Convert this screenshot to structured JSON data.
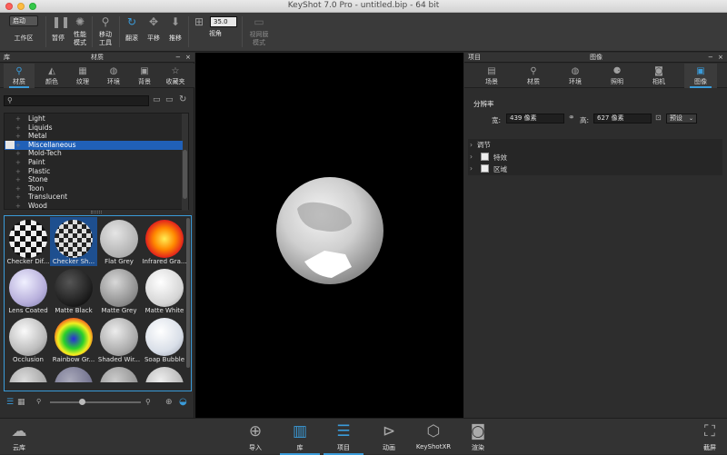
{
  "window": {
    "title": "KeyShot 7.0 Pro  -  untitled.bip  -  64 bit"
  },
  "toolbar": {
    "startup_select": "启动",
    "workspace": "工作区",
    "pause": "暂停",
    "performance": "性能\n模式",
    "move_tool": "移动\n工具",
    "tumble": "翻滚",
    "pan": "平移",
    "dolly": "推移",
    "fov_value": "35.0",
    "fov": "视角",
    "film_mode": "视网膜\n模式"
  },
  "library": {
    "header_left": "库",
    "header_center": "材质",
    "tabs": [
      "材质",
      "颜色",
      "纹理",
      "环境",
      "背景",
      "收藏夹"
    ],
    "search_placeholder": "",
    "tree": [
      "Light",
      "Liquids",
      "Metal",
      "Miscellaneous",
      "Mold-Tech",
      "Paint",
      "Plastic",
      "Stone",
      "Toon",
      "Translucent",
      "Wood"
    ],
    "selected_tree": "Miscellaneous",
    "thumbs": [
      "Checker Dif...",
      "Checker Sh...",
      "Flat Grey",
      "Infrared Gra...",
      "Lens Coated",
      "Matte Black",
      "Matte Grey",
      "Matte White",
      "Occlusion",
      "Rainbow Gr...",
      "Shaded Wir...",
      "Soap Bubble"
    ],
    "selected_thumb": "Checker Sh..."
  },
  "project": {
    "header_left": "项目",
    "header_center": "图像",
    "tabs": [
      "场景",
      "材质",
      "环境",
      "照明",
      "相机",
      "图像"
    ],
    "resolution_label": "分辨率",
    "width_label": "宽:",
    "width_value": "439 像素",
    "height_label": "高:",
    "height_value": "627 像素",
    "preset": "预设",
    "sections": [
      "调节",
      "特效",
      "区域"
    ]
  },
  "statusbar": {
    "cloud": "云库",
    "import": "导入",
    "library": "库",
    "project": "项目",
    "animation": "动画",
    "keyshotxr": "KeyShotXR",
    "render": "渲染",
    "screenshot": "截屏"
  },
  "colors": {
    "accent": "#3a9bd9",
    "selection": "#2060b8"
  }
}
